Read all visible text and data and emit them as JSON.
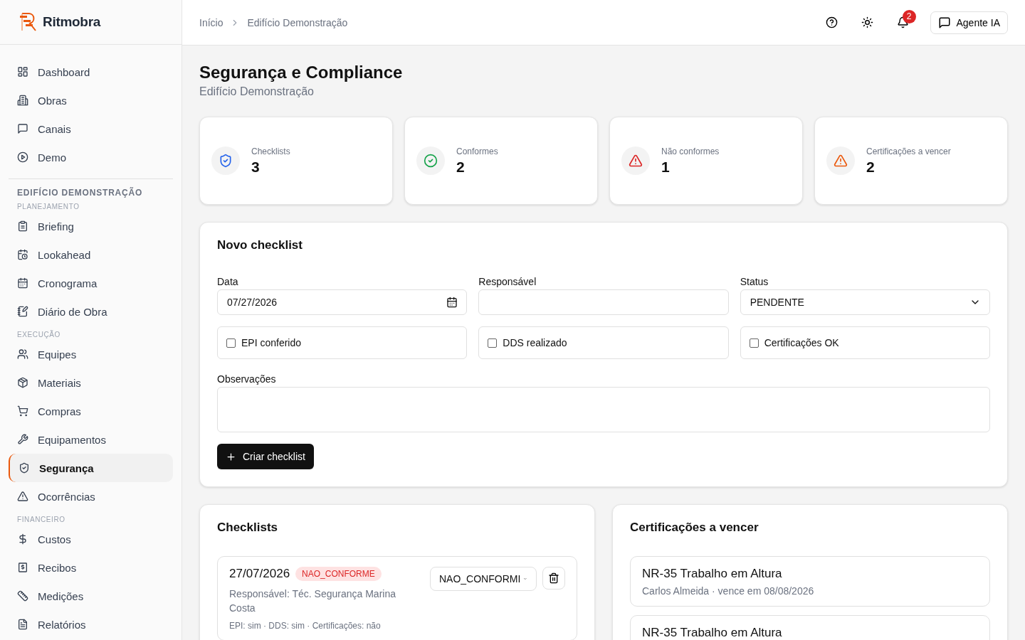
{
  "brand": {
    "name": "Ritmobra"
  },
  "sidebar": {
    "items": [
      {
        "label": "Dashboard",
        "selected": false
      },
      {
        "label": "Obras",
        "selected": false
      },
      {
        "label": "Canais",
        "selected": false
      },
      {
        "label": "Demo",
        "selected": false
      }
    ],
    "project": "EDIFÍCIO DEMONSTRAÇÃO",
    "groups": [
      {
        "title": "PLANEJAMENTO",
        "items": [
          {
            "label": "Briefing",
            "selected": false
          },
          {
            "label": "Lookahead",
            "selected": false
          },
          {
            "label": "Cronograma",
            "selected": false
          },
          {
            "label": "Diário de Obra",
            "selected": false
          }
        ]
      },
      {
        "title": "EXECUÇÃO",
        "items": [
          {
            "label": "Equipes",
            "selected": false
          },
          {
            "label": "Materiais",
            "selected": false
          },
          {
            "label": "Compras",
            "selected": false
          },
          {
            "label": "Equipamentos",
            "selected": false
          },
          {
            "label": "Segurança",
            "selected": true
          },
          {
            "label": "Ocorrências",
            "selected": false
          }
        ]
      },
      {
        "title": "FINANCEIRO",
        "items": [
          {
            "label": "Custos",
            "selected": false
          },
          {
            "label": "Recibos",
            "selected": false
          },
          {
            "label": "Medições",
            "selected": false
          },
          {
            "label": "Relatórios",
            "selected": false
          }
        ]
      }
    ]
  },
  "header": {
    "breadcrumb": [
      "Início",
      "Edifício Demonstração"
    ],
    "notification_count": "2",
    "agent_button": "Agente IA"
  },
  "page": {
    "title": "Segurança e Compliance",
    "subtitle": "Edifício Demonstração"
  },
  "stats": [
    {
      "kind": "shield",
      "label": "Checklists",
      "value": "3",
      "color": "#2563eb"
    },
    {
      "kind": "check",
      "label": "Conformes",
      "value": "2",
      "color": "#16a34a"
    },
    {
      "kind": "alert",
      "label": "Não conformes",
      "value": "1",
      "color": "#dc2626"
    },
    {
      "kind": "alert",
      "label": "Certificações a vencer",
      "value": "2",
      "color": "#ea580c"
    }
  ],
  "form": {
    "title": "Novo checklist",
    "fields": [
      {
        "kind": "date",
        "label": "Data",
        "value": "07/27/2026"
      },
      {
        "kind": "text",
        "label": "Responsável"
      },
      {
        "kind": "select",
        "label": "Status",
        "value": "PENDENTE"
      }
    ],
    "checkboxes": [
      {
        "label": "EPI conferido",
        "checked": false
      },
      {
        "label": "DDS realizado",
        "checked": false
      },
      {
        "label": "Certificações OK",
        "checked": false
      }
    ],
    "notes_label": "Observações",
    "submit": "Criar checklist"
  },
  "checklists": {
    "title": "Checklists",
    "items": [
      {
        "date": "27/07/2026",
        "status": "NAO_CONFORME",
        "responsible": "Responsável: Téc. Segurança Marina Costa",
        "details": "EPI: sim · DDS: sim · Certificações: não",
        "select_value": "NAO_CONFORMI"
      }
    ]
  },
  "certifications": {
    "title": "Certificações a vencer",
    "items": [
      {
        "name": "NR-35 Trabalho em Altura",
        "meta": "Carlos Almeida · vence em 08/08/2026"
      },
      {
        "name": "NR-35 Trabalho em Altura"
      }
    ]
  }
}
